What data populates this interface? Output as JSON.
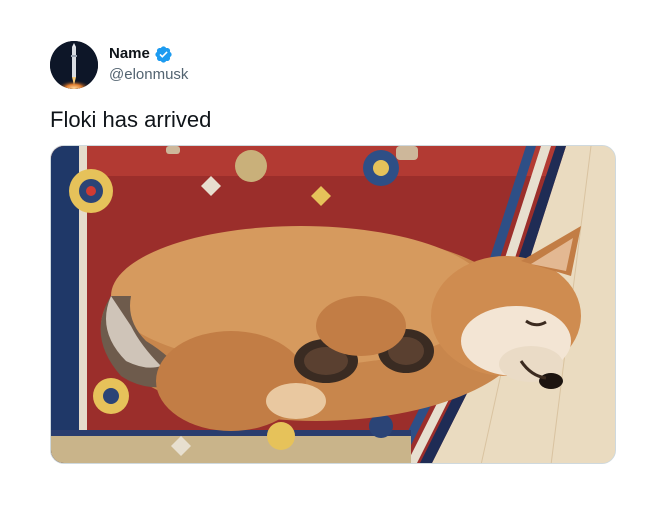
{
  "tweet": {
    "author": {
      "display_name": "Name",
      "handle": "@elonmusk",
      "verified": true,
      "avatar_icon": "rocket-launch-avatar"
    },
    "text": "Floki has arrived",
    "media": {
      "description_icon": "photo-sleeping-shiba-puppy-on-rug"
    }
  },
  "colors": {
    "verified_badge": "#1d9bf0",
    "text_primary": "#0f1419",
    "text_secondary": "#536471",
    "border": "#cfd9de"
  }
}
